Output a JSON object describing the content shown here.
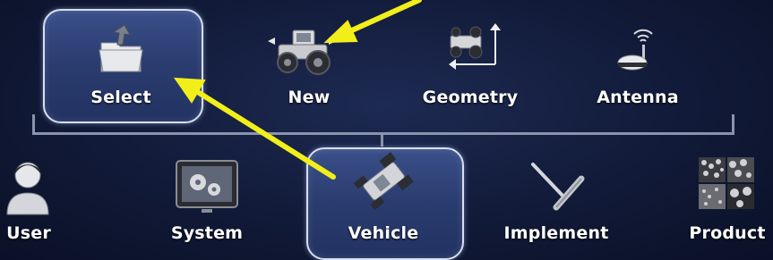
{
  "top_row": {
    "items": [
      {
        "label": "Select",
        "icon": "folder-select-icon"
      },
      {
        "label": "New",
        "icon": "tractor-icon"
      },
      {
        "label": "Geometry",
        "icon": "geometry-icon"
      },
      {
        "label": "Antenna",
        "icon": "antenna-icon"
      }
    ]
  },
  "bottom_row": {
    "items": [
      {
        "label": "User",
        "icon": "user-icon"
      },
      {
        "label": "System",
        "icon": "system-icon"
      },
      {
        "label": "Vehicle",
        "icon": "vehicle-icon"
      },
      {
        "label": "Implement",
        "icon": "implement-icon"
      },
      {
        "label": "Product",
        "icon": "product-icon"
      }
    ]
  },
  "colors": {
    "background": "#111a38",
    "selected_fill": "#2f4478",
    "selected_border": "#d8dff0",
    "arrow": "#f2ee1a",
    "tree_line": "#8a93ae"
  }
}
